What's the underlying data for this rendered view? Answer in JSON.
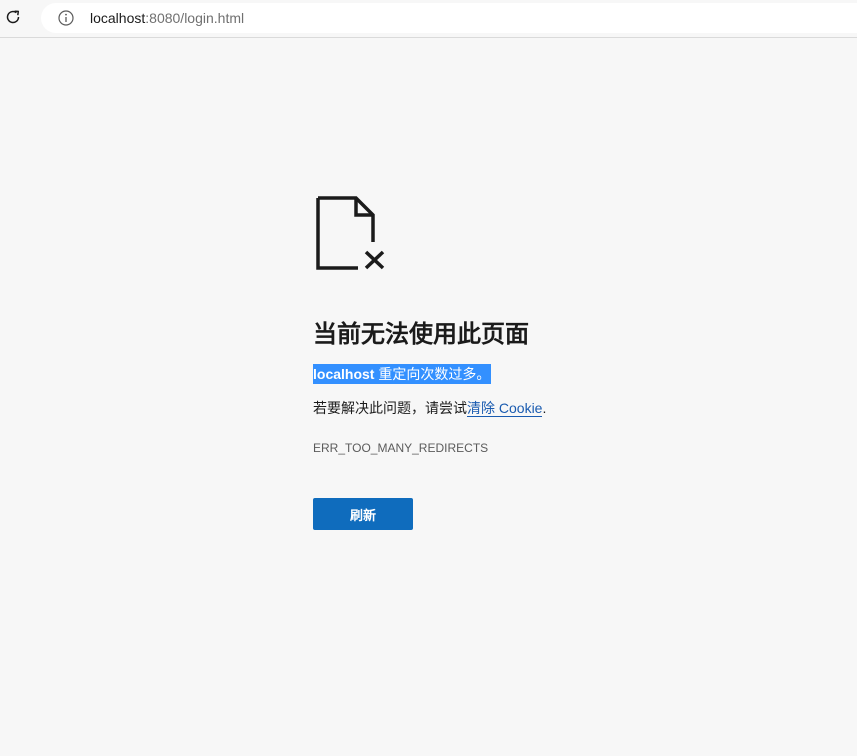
{
  "browser": {
    "url_host": "localhost",
    "url_rest": ":8080/login.html",
    "reload_icon": "reload-icon",
    "info_icon": "info-icon"
  },
  "error": {
    "icon": "broken-document-icon",
    "title": "当前无法使用此页面",
    "host": "localhost",
    "message_rest": " 重定向次数过多。",
    "suggestion_prefix": "若要解决此问题，请尝试",
    "suggestion_link": "清除 Cookie",
    "suggestion_suffix": ".",
    "code": "ERR_TOO_MANY_REDIRECTS",
    "refresh_label": "刷新"
  },
  "colors": {
    "background": "#f7f7f7",
    "button": "#0f6cbd",
    "selection": "#3390ff",
    "link": "#1a5bb0"
  }
}
